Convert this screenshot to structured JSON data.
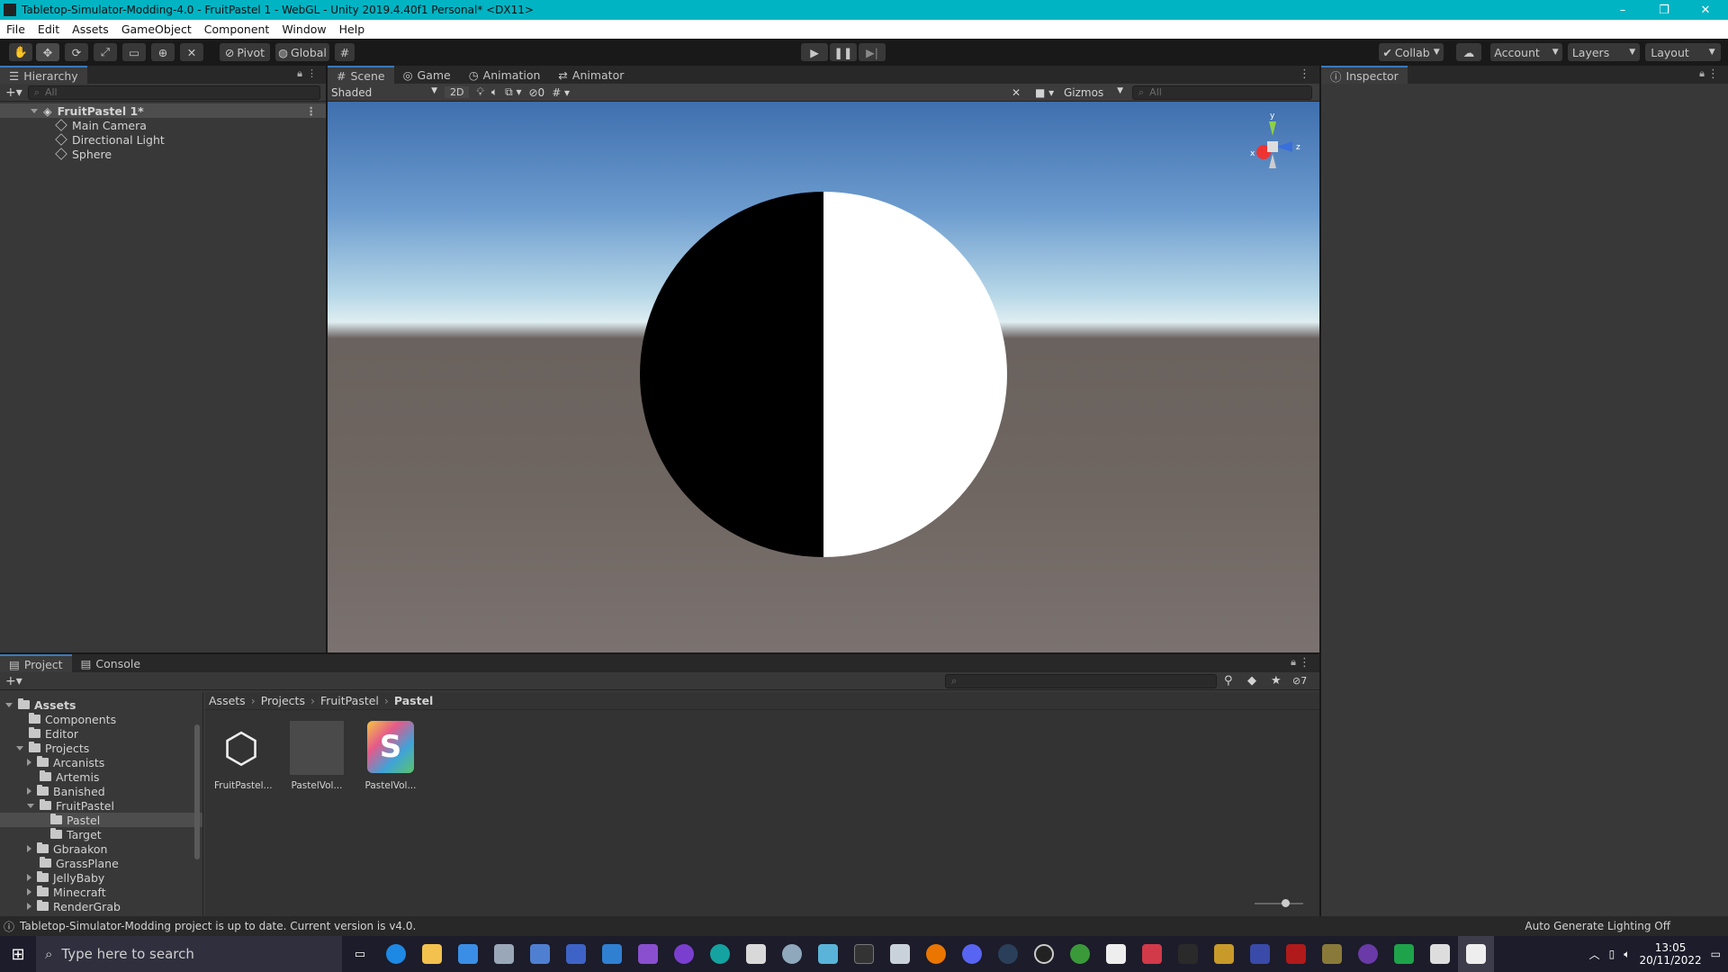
{
  "window": {
    "title": "Tabletop-Simulator-Modding-4.0 - FruitPastel 1 - WebGL - Unity 2019.4.40f1 Personal* <DX11>",
    "controls": [
      "–",
      "❐",
      "✕"
    ]
  },
  "menubar": {
    "items": [
      "File",
      "Edit",
      "Assets",
      "GameObject",
      "Component",
      "Window",
      "Help"
    ]
  },
  "toolbar": {
    "pivot_label": "Pivot",
    "global_label": "Global",
    "collab_label": "Collab",
    "account_label": "Account",
    "layers_label": "Layers",
    "layout_label": "Layout"
  },
  "hierarchy": {
    "tab_label": "Hierarchy",
    "search_placeholder": "All",
    "scene_name": "FruitPastel 1*",
    "objects": [
      "Main Camera",
      "Directional Light",
      "Sphere"
    ]
  },
  "scene": {
    "tabs": [
      "Scene",
      "Game",
      "Animation",
      "Animator"
    ],
    "shading_mode": "Shaded",
    "two_d_label": "2D",
    "hidden_count": "0",
    "gizmos_label": "Gizmos",
    "search_placeholder": "All",
    "gizmo_axes": {
      "y": "y",
      "x": "x",
      "z": "z"
    }
  },
  "inspector": {
    "tab_label": "Inspector"
  },
  "project": {
    "tabs": [
      "Project",
      "Console"
    ],
    "hidden_count": "7",
    "tree": {
      "root": "Assets",
      "items": [
        {
          "label": "Components",
          "indent": 1,
          "arrow": "none"
        },
        {
          "label": "Editor",
          "indent": 1,
          "arrow": "none"
        },
        {
          "label": "Projects",
          "indent": 1,
          "arrow": "down"
        },
        {
          "label": "Arcanists",
          "indent": 2,
          "arrow": "right"
        },
        {
          "label": "Artemis",
          "indent": 2,
          "arrow": "none"
        },
        {
          "label": "Banished",
          "indent": 2,
          "arrow": "right"
        },
        {
          "label": "FruitPastel",
          "indent": 2,
          "arrow": "down"
        },
        {
          "label": "Pastel",
          "indent": 3,
          "arrow": "none",
          "selected": true
        },
        {
          "label": "Target",
          "indent": 3,
          "arrow": "none"
        },
        {
          "label": "Gbraakon",
          "indent": 2,
          "arrow": "right"
        },
        {
          "label": "GrassPlane",
          "indent": 2,
          "arrow": "none"
        },
        {
          "label": "JellyBaby",
          "indent": 2,
          "arrow": "right"
        },
        {
          "label": "Minecraft",
          "indent": 2,
          "arrow": "right"
        },
        {
          "label": "RenderGrab",
          "indent": 2,
          "arrow": "right"
        }
      ]
    },
    "breadcrumb": [
      "Assets",
      "Projects",
      "FruitPastel",
      "Pastel"
    ],
    "assets": [
      {
        "label": "FruitPastel...",
        "kind": "unity-scene-icon"
      },
      {
        "label": "PastelVol...",
        "kind": "material-icon"
      },
      {
        "label": "PastelVol...",
        "kind": "shader-icon"
      }
    ]
  },
  "statusbar": {
    "message": "Tabletop-Simulator-Modding project is up to date. Current version is v4.0.",
    "right": "Auto Generate Lighting Off"
  },
  "taskbar": {
    "search_placeholder": "Type here to search",
    "time": "13:05",
    "date": "20/11/2022"
  },
  "colors": {
    "titlebar": "#00b4c4",
    "editor_bg": "#383838",
    "accent": "#3a79bb"
  }
}
